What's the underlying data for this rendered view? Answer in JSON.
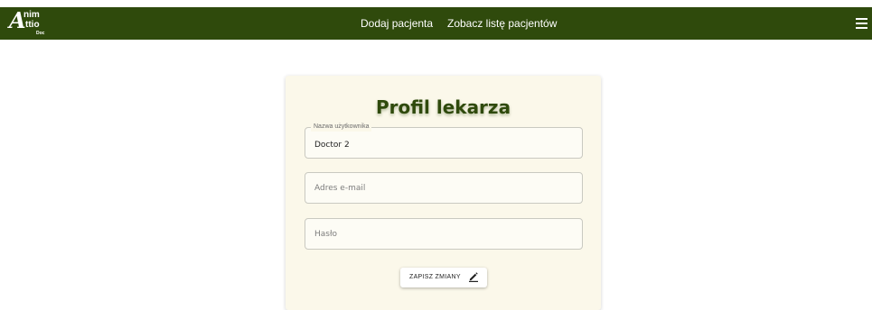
{
  "header": {
    "logo": {
      "big_letter": "A",
      "line1": "nim",
      "line2": "ttio",
      "line3": "Doc"
    },
    "nav": [
      {
        "label": "Dodaj pacjenta"
      },
      {
        "label": "Zobacz listę pacjentów"
      }
    ],
    "menu_icon": "hamburger-menu-icon"
  },
  "profile": {
    "title": "Profil lekarza",
    "username": {
      "label": "Nazwa użytkownika",
      "value": "Doctor 2"
    },
    "email": {
      "placeholder": "Adres e-mail",
      "value": ""
    },
    "password": {
      "placeholder": "Hasło",
      "value": ""
    },
    "save_button": {
      "label": "ZAPISZ ZMIANY",
      "icon": "pencil-edit-icon"
    }
  },
  "colors": {
    "brand_green": "#2f4a0c",
    "card_background": "#fbf8ea",
    "page_background": "#ffffff"
  }
}
